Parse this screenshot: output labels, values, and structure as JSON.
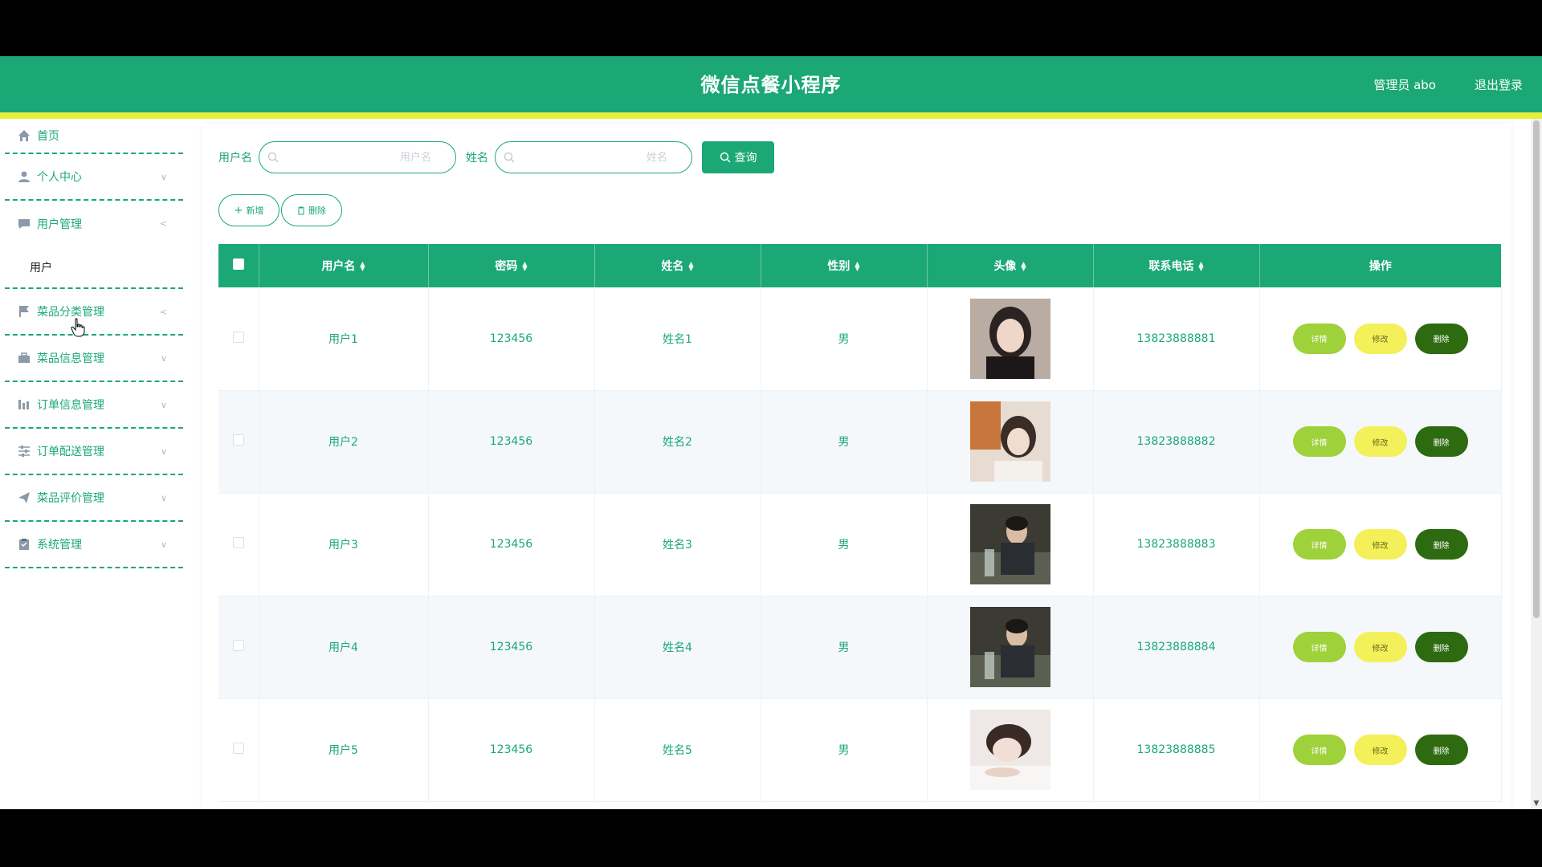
{
  "header": {
    "title": "微信点餐小程序",
    "admin_label": "管理员 abo",
    "logout_label": "退出登录"
  },
  "sidebar": {
    "home": "首页",
    "items": [
      {
        "label": "个人中心",
        "icon": "person-icon"
      },
      {
        "label": "用户管理",
        "icon": "chat-icon",
        "expanded": true,
        "sub": "用户"
      },
      {
        "label": "菜品分类管理",
        "icon": "flag-icon"
      },
      {
        "label": "菜品信息管理",
        "icon": "briefcase-icon"
      },
      {
        "label": "订单信息管理",
        "icon": "chart-icon"
      },
      {
        "label": "订单配送管理",
        "icon": "sliders-icon"
      },
      {
        "label": "菜品评价管理",
        "icon": "send-icon"
      },
      {
        "label": "系统管理",
        "icon": "clipboard-icon"
      }
    ]
  },
  "search": {
    "username_label": "用户名",
    "username_placeholder": "用户名",
    "name_label": "姓名",
    "name_placeholder": "姓名",
    "query_label": "查询"
  },
  "actions": {
    "add_label": "新增",
    "delete_label": "删除"
  },
  "table": {
    "columns": [
      "用户名",
      "密码",
      "姓名",
      "性别",
      "头像",
      "联系电话",
      "操作"
    ],
    "op_detail": "详情",
    "op_edit": "修改",
    "op_delete": "删除",
    "rows": [
      {
        "username": "用户1",
        "password": "123456",
        "name": "姓名1",
        "gender": "男",
        "phone": "13823888881"
      },
      {
        "username": "用户2",
        "password": "123456",
        "name": "姓名2",
        "gender": "男",
        "phone": "13823888882"
      },
      {
        "username": "用户3",
        "password": "123456",
        "name": "姓名3",
        "gender": "男",
        "phone": "13823888883"
      },
      {
        "username": "用户4",
        "password": "123456",
        "name": "姓名4",
        "gender": "男",
        "phone": "13823888884"
      },
      {
        "username": "用户5",
        "password": "123456",
        "name": "姓名5",
        "gender": "男",
        "phone": "13823888885"
      }
    ]
  },
  "colors": {
    "primary": "#1ba876",
    "accent_line": "#e5ee3b",
    "detail_btn": "#9ed13a",
    "edit_btn": "#f3f05a",
    "delete_btn": "#2e6a10"
  }
}
